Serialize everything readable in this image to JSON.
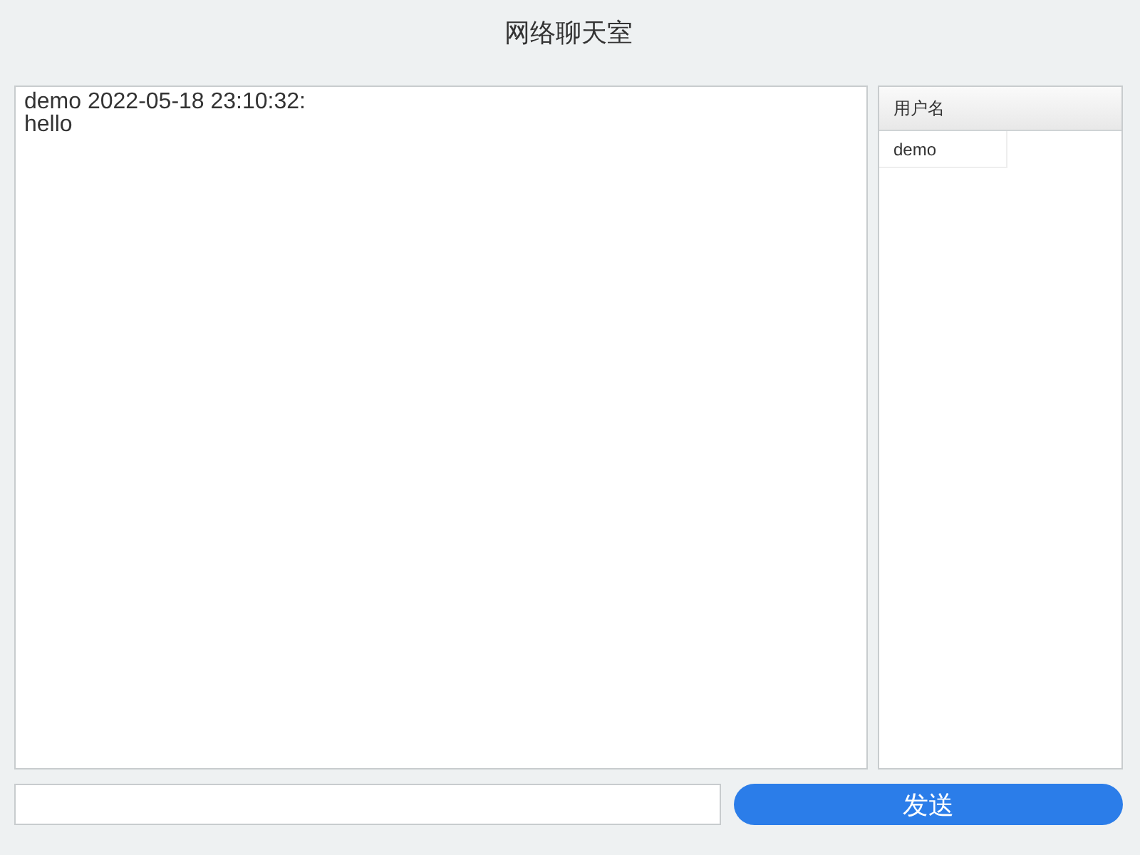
{
  "title": "网络聊天室",
  "messages": [
    {
      "header": "demo 2022-05-18 23:10:32:",
      "body": "hello"
    }
  ],
  "user_list": {
    "column": "用户名",
    "users": [
      "demo"
    ]
  },
  "send_button": "发送"
}
